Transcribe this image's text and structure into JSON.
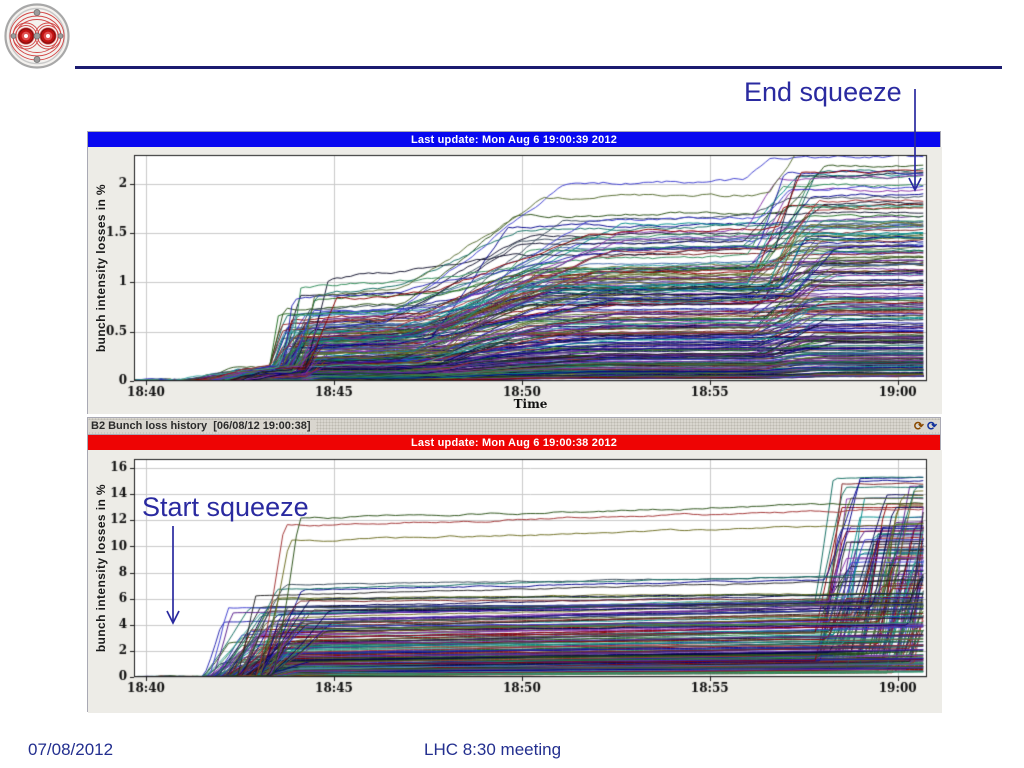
{
  "slide": {
    "footer_date": "07/08/2012",
    "footer_title": "LHC 8:30 meeting",
    "annotations": {
      "end_squeeze": "End squeeze",
      "start_squeeze": "Start squeeze"
    },
    "colors": {
      "accent_navy": "#2a2aa0",
      "top_rule": "#1b1b70",
      "footer_text": "#232f8f"
    },
    "logo": "lhc-magnet-cross-section-logo"
  },
  "panels": [
    {
      "id": "b1",
      "titlebar": {
        "text": "Last update: Mon Aug  6 19:00:39 2012",
        "color": "#0808f0"
      }
    },
    {
      "id": "b2",
      "toolbar": {
        "title": "B2 Bunch loss history  [06/08/12 19:00:38]",
        "icons": [
          "refresh-icon",
          "refresh-icon"
        ]
      },
      "titlebar": {
        "text": "Last update: Mon Aug  6 19:00:38 2012",
        "color": "#ee0404"
      }
    }
  ],
  "chart_data": [
    {
      "type": "line",
      "title": "Last update: Mon Aug  6 19:00:39 2012",
      "ylabel": "bunch intensity losses in %",
      "xlabel": "Time",
      "x_ticks": [
        "18:40",
        "18:45",
        "18:50",
        "18:55",
        "19:00"
      ],
      "x_ticks_minutes": [
        0,
        5,
        10,
        15,
        20
      ],
      "xlim_minutes": [
        -0.32,
        20.78
      ],
      "y_ticks": [
        0,
        0.5,
        1,
        1.5,
        2
      ],
      "ylim": [
        0,
        2.29
      ],
      "grid": true,
      "legend": "none",
      "description": "Beam-1 per-bunch intensity loss traces (hundreds of bunches). All at ~0% until 18:42; step up near 18:43 to 0.05-0.9%; gradual ramp 18:46-18:50; final step near 18:56 (end of squeeze); dense band 0.1-1.7% at 19:00 with top traces reaching ~2.1-2.2%.",
      "series_synthesis": {
        "profile": "stepped_rise",
        "n_lines": 260,
        "seed": 20120806,
        "final_max": 2.18,
        "final_exp": 2.0,
        "flat_until": [
          0.9,
          2.6
        ],
        "step1_time": [
          3.2,
          4.3
        ],
        "step1_frac": [
          0.16,
          0.5
        ],
        "ramp2_start": [
          6.2,
          8.2
        ],
        "ramp2_end": [
          9.4,
          12.8
        ],
        "ramp2_frac": [
          0.6,
          0.88
        ],
        "step3_time": [
          15.9,
          17.3
        ],
        "noise": 0.013
      },
      "palette": [
        "#00004f",
        "#00008b",
        "#2222b0",
        "#3b3bd0",
        "#4169aa",
        "#274e13",
        "#1e6b1e",
        "#2e8b57",
        "#0f6b5f",
        "#008b8b",
        "#3aa6a0",
        "#556b2f",
        "#6b6b1f",
        "#7a2020",
        "#8b0000",
        "#a03030",
        "#551a8b",
        "#6a2ca0",
        "#8833aa",
        "#202020",
        "#10102a",
        "#394a5a"
      ]
    },
    {
      "type": "line",
      "title": "Last update: Mon Aug  6 19:00:38 2012",
      "ylabel": "bunch intensity losses in %",
      "xlabel": "",
      "x_ticks": [
        "18:40",
        "18:45",
        "18:50",
        "18:55",
        "19:00"
      ],
      "x_ticks_minutes": [
        0,
        5,
        10,
        15,
        20
      ],
      "xlim_minutes": [
        -0.32,
        20.78
      ],
      "y_ticks": [
        0,
        2,
        4,
        6,
        8,
        10,
        12,
        14,
        16
      ],
      "ylim": [
        0,
        16.7
      ],
      "grid": true,
      "legend": "none",
      "description": "Beam-2 per-bunch intensity loss traces. Flat at 0% until ~18:41 (start of squeeze); steep rises 18:42-18:44 to plateaus mostly 0.2-6.5% with outliers near 10.4, 11.6 and 12.1%; slow upward drift until ~18:57; many traces spike steeply between 18:58 and 19:00 up to ~14-16%.",
      "series_synthesis": {
        "profile": "plateau_spike",
        "n_lines": 215,
        "seed": 19003812,
        "plateau_min": 0.1,
        "plateau_span": 6.6,
        "plateau_exp": 2.6,
        "outliers": [
          12.1,
          11.6,
          10.4
        ],
        "rise_start": [
          1.5,
          3.3
        ],
        "rise_dur": [
          0.4,
          1.7
        ],
        "drift_total": [
          0.15,
          1.4
        ],
        "spike_prob": 0.55,
        "spike_time": [
          17.8,
          20.5
        ],
        "spike_dur": [
          0.25,
          0.9
        ],
        "spike_add": [
          2.5,
          11.0
        ],
        "spike_cap": 15.9,
        "noise": 0.05
      },
      "palette": [
        "#00004f",
        "#00008b",
        "#2222b0",
        "#3b3bd0",
        "#4169aa",
        "#274e13",
        "#1e6b1e",
        "#2e8b57",
        "#0f6b5f",
        "#008b8b",
        "#3aa6a0",
        "#556b2f",
        "#6b6b1f",
        "#7a2020",
        "#8b0000",
        "#a03030",
        "#551a8b",
        "#6a2ca0",
        "#8833aa",
        "#202020",
        "#10102a",
        "#394a5a"
      ]
    }
  ]
}
